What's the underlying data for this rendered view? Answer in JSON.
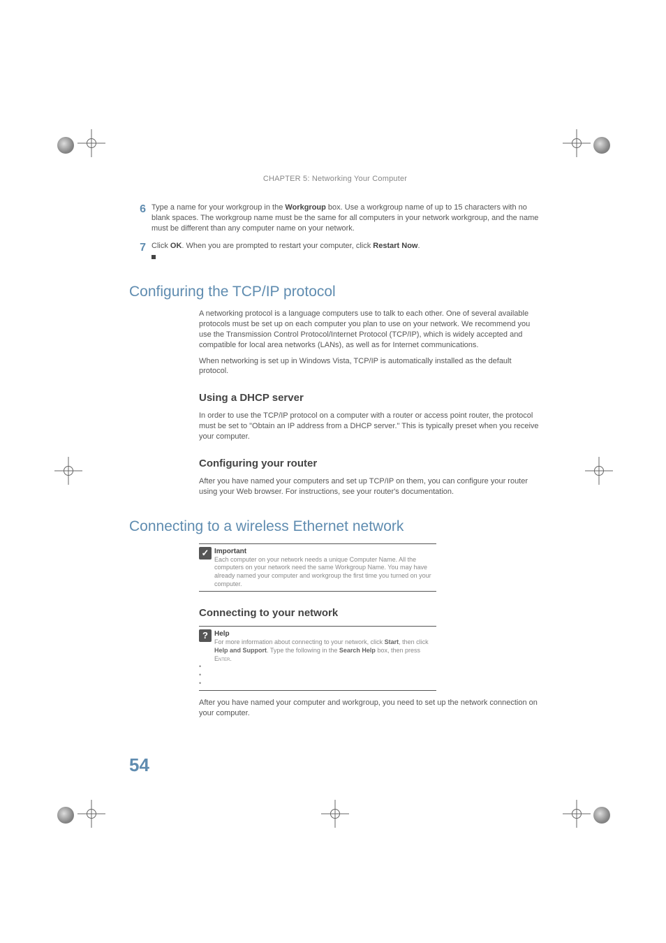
{
  "header": {
    "chapter": "CHAPTER 5: Networking Your Computer"
  },
  "steps": {
    "s6": {
      "num": "6",
      "t1": "Type a name for your workgroup in the ",
      "b1": "Workgroup",
      "t2": " box. Use a workgroup name of up to 15 characters with no blank spaces. The workgroup name must be the same for all computers in your network workgroup, and the name must be different than any computer name on your network."
    },
    "s7": {
      "num": "7",
      "t1": "Click ",
      "b1": "OK",
      "t2": ". When you are prompted to restart your computer, click ",
      "b2": "Restart Now",
      "t3": "."
    }
  },
  "sec1": {
    "title": "Configuring the TCP/IP protocol",
    "p1": "A networking protocol is a language computers use to talk to each other. One of several available protocols must be set up on each computer you plan to use on your network. We recommend you use the Transmission Control Protocol/Internet Protocol (TCP/IP), which is widely accepted and compatible for local area networks (LANs), as well as for Internet communications.",
    "p2": "When networking is set up in Windows Vista, TCP/IP is automatically installed as the default protocol.",
    "h2a": "Using a DHCP server",
    "p3": "In order to use the TCP/IP protocol on a computer with a router or access point router, the protocol must be set to \"Obtain an IP address from a DHCP server.\" This is typically preset when you receive your computer.",
    "h2b": "Configuring your router",
    "p4": "After you have named your computers and set up TCP/IP on them, you can configure your router using your Web browser. For instructions, see your router's documentation."
  },
  "sec2": {
    "title": "Connecting to a wireless Ethernet network",
    "important": {
      "label": "Important",
      "body": "Each computer on your network needs a unique Computer Name. All the computers on your network need the same Workgroup Name. You may have already named your computer and workgroup the first time you turned on your computer."
    },
    "h2a": "Connecting to your network",
    "help": {
      "label": "Help",
      "t1": "For more information about connecting to your network, click ",
      "b1": "Start",
      "t2": ", then click ",
      "b2": "Help and Support",
      "t3": ". Type the following in the ",
      "b3": "Search Help",
      "t4": " box, then press ",
      "sc": "Enter",
      "t5": "."
    },
    "p1": "After you have named your computer and workgroup, you need to set up the network connection on your computer."
  },
  "pageNumber": "54"
}
